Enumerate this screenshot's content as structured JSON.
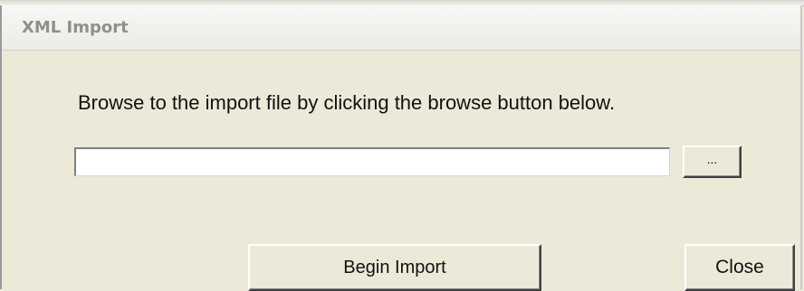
{
  "window": {
    "title": "XML Import"
  },
  "dialog": {
    "instruction": "Browse to the import file by clicking the browse button below.",
    "file_path": {
      "value": "",
      "placeholder": ""
    },
    "browse_label": "...",
    "begin_import_label": "Begin Import",
    "close_label": "Close"
  }
}
